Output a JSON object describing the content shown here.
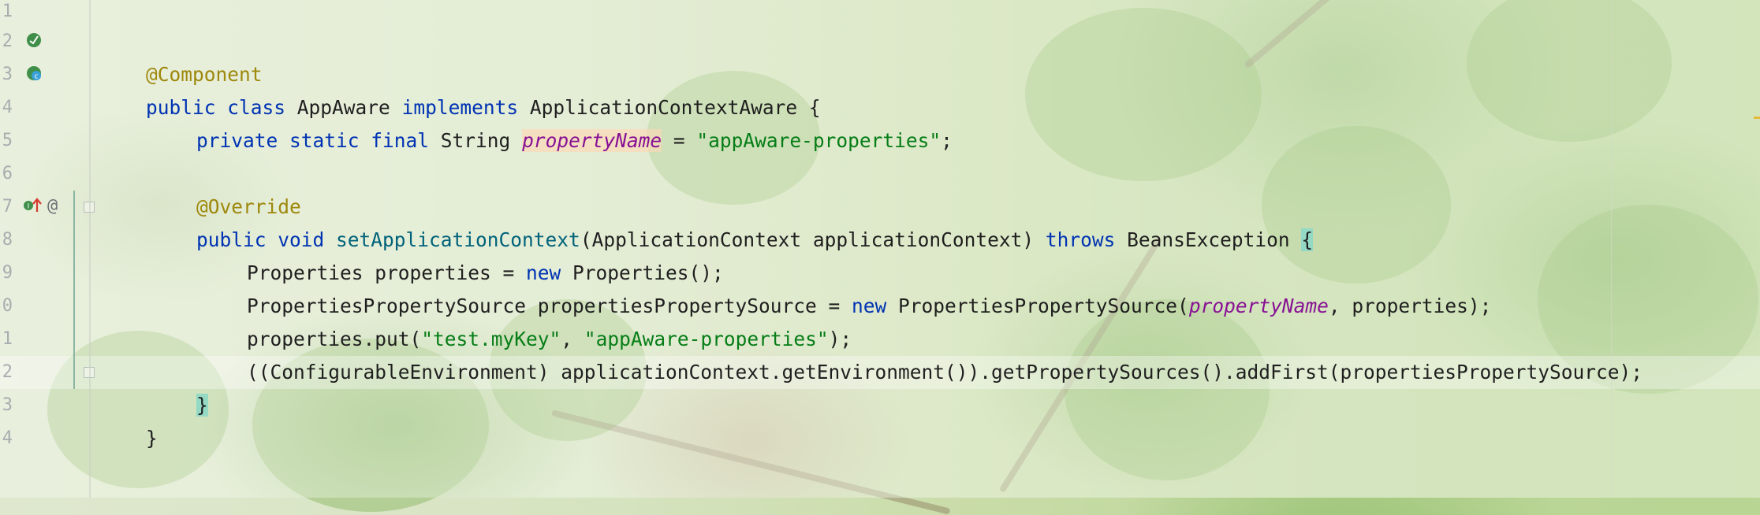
{
  "editor": {
    "line_numbers": [
      "1",
      "2",
      "3",
      "4",
      "5",
      "6",
      "7",
      "8",
      "9",
      "0",
      "1",
      "2",
      "3",
      "4"
    ],
    "gutter_icons": {
      "line2_bean": "bean-icon",
      "line3_class": "class-icon",
      "line7_override": "override-icon",
      "line7_at": "@"
    },
    "lines": {
      "l2": {
        "annotation": "@Component"
      },
      "l3": {
        "kw1": "public class",
        "name": "AppAware",
        "kw2": "implements",
        "iface": "ApplicationContextAware",
        "brace": "{"
      },
      "l4": {
        "kw": "private static final",
        "type": "String",
        "field": "propertyName",
        "eq": "=",
        "str": "\"appAware-properties\"",
        "end": ";"
      },
      "l6": {
        "annotation": "@Override"
      },
      "l7": {
        "kw": "public void",
        "method": "setApplicationContext",
        "params": "(ApplicationContext applicationContext)",
        "throws": "throws",
        "exc": "BeansException",
        "brace": "{"
      },
      "l8": {
        "pre": "Properties properties = ",
        "kw": "new",
        "post": " Properties();"
      },
      "l9": {
        "pre": "PropertiesPropertySource propertiesPropertySource = ",
        "kw": "new",
        "mid": " PropertiesPropertySource(",
        "field": "propertyName",
        "post": ", properties);"
      },
      "l10": {
        "pre": "properties.put(",
        "str1": "\"test.myKey\"",
        "comma": ", ",
        "str2": "\"appAware-properties\"",
        "post": ");"
      },
      "l11": {
        "text": "((ConfigurableEnvironment) applicationContext.getEnvironment()).getPropertySources().addFirst(propertiesPropertySource);"
      },
      "l12": {
        "brace": "}"
      },
      "l13": {
        "brace": "}"
      }
    },
    "colors": {
      "keyword": "#0033b3",
      "annotation": "#9e880d",
      "string": "#067d17",
      "field": "#871094",
      "method": "#00627a"
    }
  }
}
